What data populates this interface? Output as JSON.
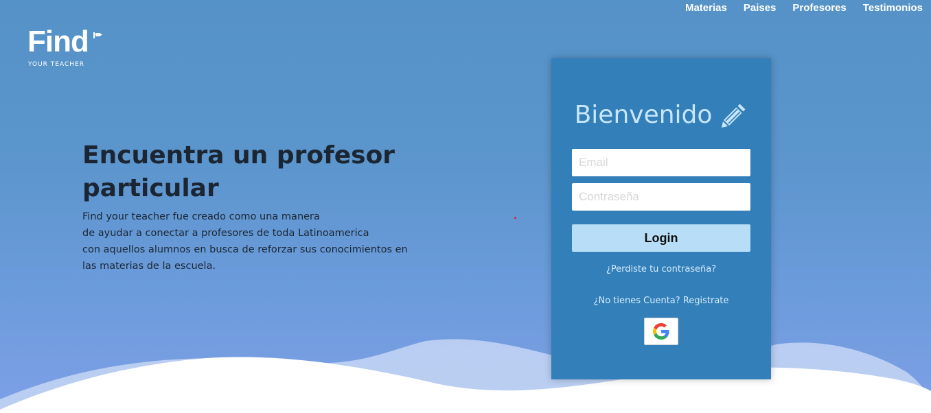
{
  "nav": {
    "items": [
      "Materias",
      "Paises",
      "Profesores",
      "Testimonios"
    ]
  },
  "logo": {
    "word": "Find",
    "tagline": "YOUR TEACHER"
  },
  "hero": {
    "title": "Encuentra un profesor particular",
    "description_lines": [
      "Find your teacher fue creado como una manera",
      "de ayudar a conectar a profesores de toda Latinoamerica",
      "con aquellos alumnos en busca de reforzar sus conocimientos en",
      "las materias de la escuela."
    ]
  },
  "login": {
    "title": "Bienvenido",
    "title_icon": "pencil-icon",
    "email": {
      "value": "",
      "placeholder": "Email"
    },
    "password": {
      "value": "",
      "placeholder": "Contraseña"
    },
    "submit_label": "Login",
    "forgot_label": "¿Perdiste tu contraseña?",
    "register_label": "¿No tienes Cuenta? Registrate",
    "google_icon": "google-icon"
  },
  "colors": {
    "background_top": "#5592c7",
    "background_bottom": "#7ea0e6",
    "card": "#327fb9",
    "button": "#b8def7",
    "title_text": "#c9e6fb"
  }
}
